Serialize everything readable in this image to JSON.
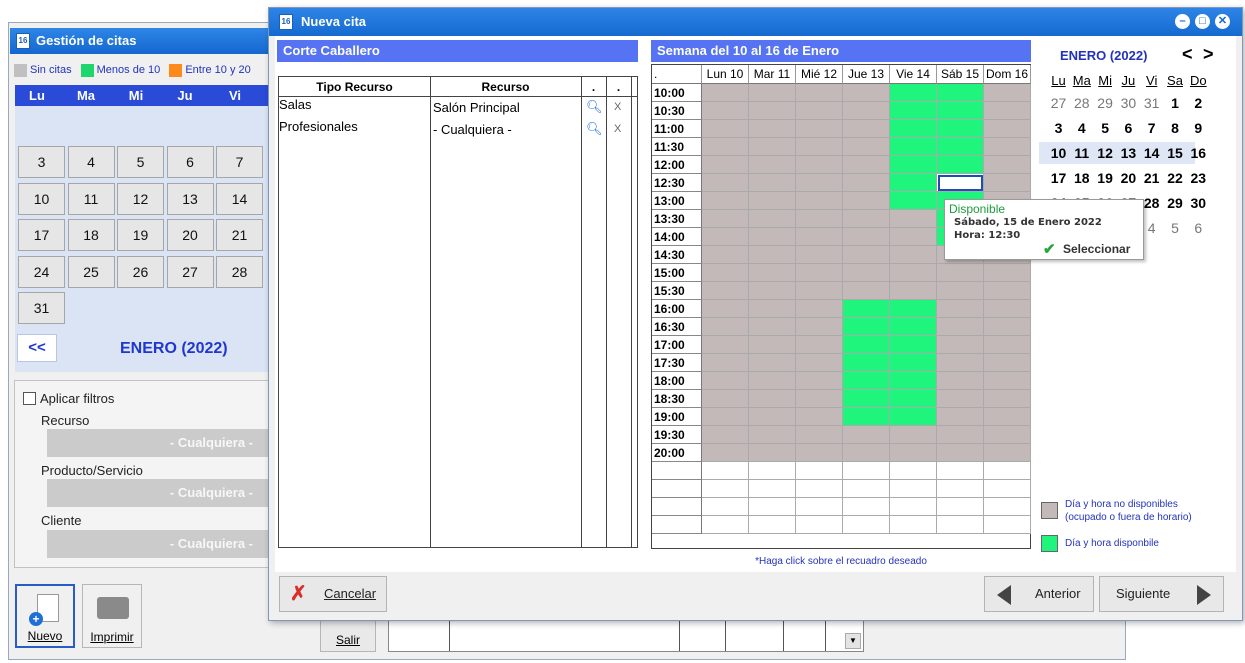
{
  "bg": {
    "title": "Gestión de citas",
    "legend": [
      {
        "label": "Sin citas",
        "color": "#c0c0c0"
      },
      {
        "label": "Menos de 10",
        "color": "#1ed66c"
      },
      {
        "label": "Entre 10 y 20",
        "color": "#ff8a1c"
      }
    ],
    "weekdays": [
      "Lu",
      "Ma",
      "Mi",
      "Ju",
      "Vi"
    ],
    "days": [
      "3",
      "4",
      "5",
      "6",
      "7",
      "10",
      "11",
      "12",
      "13",
      "14",
      "17",
      "18",
      "19",
      "20",
      "21",
      "24",
      "25",
      "26",
      "27",
      "28",
      "31"
    ],
    "prev_label": "<<",
    "month_label": "ENERO  (2022)",
    "filters": {
      "apply_label": "Aplicar filtros",
      "resource_label": "Recurso",
      "resource_value": "- Cualquiera -",
      "product_label": "Producto/Servicio",
      "product_value": "- Cualquiera -",
      "client_label": "Cliente",
      "client_value": "- Cualquiera -"
    },
    "new_label": "Nuevo",
    "print_label": "Imprimir",
    "exit_label": "Salir"
  },
  "modal": {
    "title": "Nueva cita",
    "service_title": "Corte Caballero",
    "resources": {
      "headers": [
        "Tipo Recurso",
        "Recurso",
        ".",
        "."
      ],
      "rows": [
        {
          "type": "Salas",
          "resource": "Salón Principal"
        },
        {
          "type": "Profesionales",
          "resource": "- Cualquiera -"
        }
      ],
      "remove_glyph": "X"
    },
    "week_title": "Semana del 10 al 16 de Enero",
    "schedule": {
      "corner": ".",
      "days": [
        "Lun 10",
        "Mar 11",
        "Mié 12",
        "Jue 13",
        "Vie 14",
        "Sáb 15",
        "Dom 16"
      ],
      "times": [
        "10:00",
        "10:30",
        "11:00",
        "11:30",
        "12:00",
        "12:30",
        "13:00",
        "13:30",
        "14:00",
        "14:30",
        "15:00",
        "15:30",
        "16:00",
        "16:30",
        "17:00",
        "17:30",
        "18:00",
        "18:30",
        "19:00",
        "19:30",
        "20:00"
      ],
      "available": [
        "4:0",
        "4:1",
        "4:2",
        "4:3",
        "4:4",
        "4:5",
        "4:6",
        "5:0",
        "5:1",
        "5:2",
        "5:3",
        "5:4",
        "5:6",
        "5:7",
        "5:8",
        "3:12",
        "3:13",
        "3:14",
        "3:15",
        "3:16",
        "3:17",
        "3:18",
        "4:12",
        "4:13",
        "4:14",
        "4:15",
        "4:16",
        "4:17",
        "4:18"
      ],
      "selected": "5:5",
      "note": "*Haga click sobre el recuadro deseado"
    },
    "tooltip": {
      "title": "Disponible",
      "date": "Sábado, 15 de Enero 2022",
      "time": "Hora: 12:30",
      "action": "Seleccionar"
    },
    "calendar": {
      "month": "ENERO  (2022)",
      "prev": "<",
      "next": ">",
      "weekdays": [
        "Lu",
        "Ma",
        "Mi",
        "Ju",
        "Vi",
        "Sa",
        "Do"
      ],
      "weeks": [
        [
          "27",
          "28",
          "29",
          "30",
          "31",
          "1",
          "2"
        ],
        [
          "3",
          "4",
          "5",
          "6",
          "7",
          "8",
          "9"
        ],
        [
          "10",
          "11",
          "12",
          "13",
          "14",
          "15",
          "16"
        ],
        [
          "17",
          "18",
          "19",
          "20",
          "21",
          "22",
          "23"
        ],
        [
          "24",
          "25",
          "26",
          "27",
          "28",
          "29",
          "30"
        ],
        [
          "31",
          "1",
          "2",
          "3",
          "4",
          "5",
          "6"
        ]
      ]
    },
    "legend": {
      "unavailable": "Día y hora no disponibles (ocupado o fuera de horario)",
      "available": "Día y hora disponbile",
      "unavailable_color": "#c3b9b9",
      "available_color": "#1ff57c"
    },
    "footer": {
      "cancel": "Cancelar",
      "previous": "Anterior",
      "next": "Siguiente"
    }
  }
}
